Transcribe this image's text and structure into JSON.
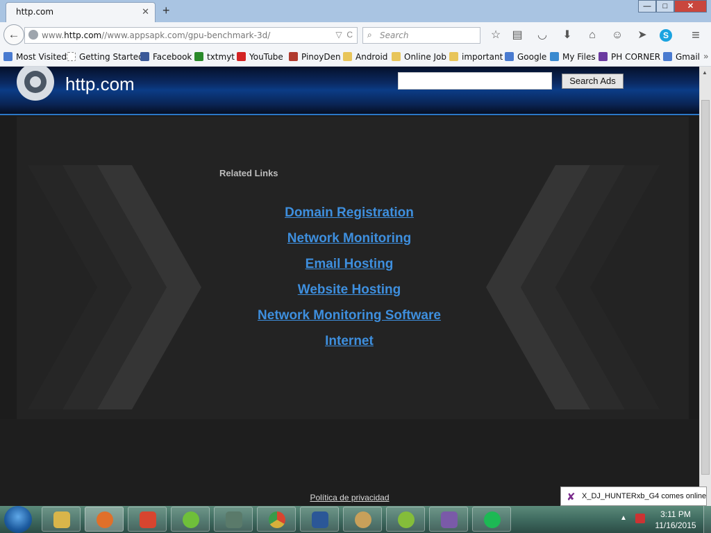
{
  "browser": {
    "tab_title": "http.com",
    "tab_close": "✕",
    "new_tab": "+",
    "window": {
      "minimize": "—",
      "maximize": "□",
      "close": "✕"
    },
    "back": "←",
    "url_prefix": "www.",
    "url_host": "http.com",
    "url_rest": "//www.appsapk.com/gpu-benchmark-3d/",
    "url_dropdown": "▽",
    "url_reload": "C",
    "search_placeholder": "Search",
    "search_glyph": "⌕",
    "toolbar_icons": [
      "bookmark-star-icon",
      "reading-list-icon",
      "pocket-icon",
      "download-icon",
      "home-icon",
      "hello-icon",
      "share-icon",
      "skype-icon",
      "menu-icon"
    ],
    "toolbar_glyphs": [
      "☆",
      "▤",
      "◡",
      "⬇",
      "⌂",
      "☺",
      "➤",
      "S",
      "≡"
    ]
  },
  "bookmarks": {
    "items": [
      {
        "label": "Most Visited",
        "color": "#4a7bd0"
      },
      {
        "label": "Getting Started",
        "color": "#ffffff"
      },
      {
        "label": "Facebook",
        "color": "#3b5998"
      },
      {
        "label": "txtmyt",
        "color": "#2a8a2a"
      },
      {
        "label": "YouTube",
        "color": "#d32323"
      },
      {
        "label": "PinoyDen",
        "color": "#b03a2e"
      },
      {
        "label": "Android",
        "color": "#e8c55a"
      },
      {
        "label": "Online Job",
        "color": "#e8c55a"
      },
      {
        "label": "important",
        "color": "#e8c55a"
      },
      {
        "label": "Google",
        "color": "#4a7bd0"
      },
      {
        "label": "My Files",
        "color": "#3a8ad0"
      },
      {
        "label": "PH CORNER",
        "color": "#6a3aa0"
      },
      {
        "label": "Gmail",
        "color": "#4a7bd0"
      }
    ],
    "more": "»"
  },
  "site": {
    "name": "http.com",
    "search_button": "Search Ads",
    "related_title": "Related Links",
    "links": [
      "Domain Registration",
      "Network Monitoring",
      "Email Hosting",
      "Website Hosting",
      "Network Monitoring Software",
      "Internet"
    ],
    "footer_link": "Política de privacidad"
  },
  "notification": {
    "text": "X_DJ_HUNTERxb_G4 comes online"
  },
  "taskbar": {
    "apps": [
      {
        "name": "explorer-icon",
        "color": "#d9b54a"
      },
      {
        "name": "firefox-icon",
        "color": "#e0702a"
      },
      {
        "name": "ccleaner-icon",
        "color": "#d8452f"
      },
      {
        "name": "utorrent-icon",
        "color": "#6fbf3a"
      },
      {
        "name": "task-manager-icon",
        "color": "#5a7a6a"
      },
      {
        "name": "chrome-icon",
        "color": "#d8b03a"
      },
      {
        "name": "word-icon",
        "color": "#2b5797"
      },
      {
        "name": "paint-icon",
        "color": "#c8a05a"
      },
      {
        "name": "spotify-icon",
        "color": "#84bd3a"
      },
      {
        "name": "visual-studio-icon",
        "color": "#7a5aa8"
      },
      {
        "name": "spotify-icon",
        "color": "#1db954"
      }
    ],
    "clock_time": "3:11 PM",
    "clock_date": "11/16/2015"
  }
}
